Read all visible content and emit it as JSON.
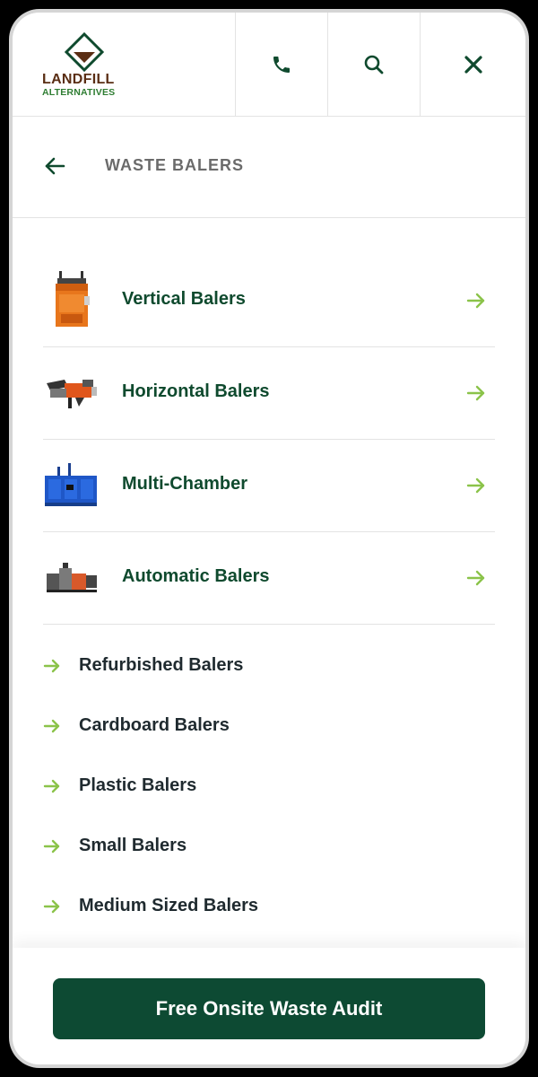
{
  "brand": {
    "line1": "LANDFILL",
    "line2": "ALTERNATIVES",
    "colors": {
      "primary": "#0f4a2e",
      "accent": "#8bc34a",
      "brown": "#5a2e14"
    }
  },
  "header": {
    "phone_icon": "phone-icon",
    "search_icon": "search-icon",
    "close_icon": "close-icon"
  },
  "subnav": {
    "back_icon": "back-arrow-icon",
    "title": "WASTE BALERS"
  },
  "featured": [
    {
      "label": "Vertical Balers",
      "icon": "vertical-baler-image"
    },
    {
      "label": "Horizontal Balers",
      "icon": "horizontal-baler-image"
    },
    {
      "label": "Multi-Chamber",
      "icon": "multi-chamber-baler-image"
    },
    {
      "label": "Automatic Balers",
      "icon": "automatic-baler-image"
    }
  ],
  "links": [
    {
      "label": "Refurbished Balers"
    },
    {
      "label": "Cardboard Balers"
    },
    {
      "label": "Plastic Balers"
    },
    {
      "label": "Small Balers"
    },
    {
      "label": "Medium Sized Balers"
    }
  ],
  "cta": {
    "label": "Free Onsite Waste Audit"
  }
}
